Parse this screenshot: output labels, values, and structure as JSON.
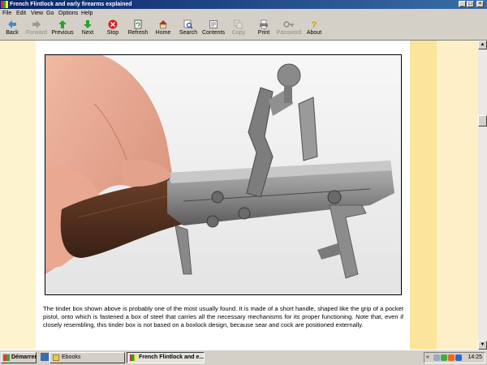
{
  "window": {
    "title": "French Flintlock and early firearms explained",
    "controls": [
      "_",
      "□",
      "×"
    ]
  },
  "menu": [
    "File",
    "Edit",
    "View",
    "Go",
    "Options",
    "Help"
  ],
  "toolbar": [
    {
      "label": "Back",
      "icon": "back-arrow-icon",
      "enabled": true
    },
    {
      "label": "Forward",
      "icon": "forward-arrow-icon",
      "enabled": false
    },
    {
      "label": "Previous",
      "icon": "up-arrow-icon",
      "enabled": true
    },
    {
      "label": "Next",
      "icon": "down-arrow-icon",
      "enabled": true
    },
    {
      "label": "Stop",
      "icon": "stop-icon",
      "enabled": true
    },
    {
      "label": "Refresh",
      "icon": "refresh-icon",
      "enabled": true
    },
    {
      "label": "Home",
      "icon": "home-icon",
      "enabled": true
    },
    {
      "label": "Search",
      "icon": "search-icon",
      "enabled": true
    },
    {
      "label": "Contents",
      "icon": "contents-icon",
      "enabled": true
    },
    {
      "label": "Copy",
      "icon": "copy-icon",
      "enabled": false
    },
    {
      "label": "Print",
      "icon": "print-icon",
      "enabled": true
    },
    {
      "label": "Password",
      "icon": "key-icon",
      "enabled": false
    },
    {
      "label": "About",
      "icon": "about-icon",
      "enabled": true
    }
  ],
  "page": {
    "body_text": "The tinder box shown above is probably one of the most usually found. It is made of a short handle, shaped like the grip of a pocket pistol, onto which is fastened a box of steel that carries all the necessary mechanisms for its proper functioning. Note that, even if closely resembling, this tinder box is not based on a boxlock design, because sear and cock are positioned externally."
  },
  "taskbar": {
    "start_label": "Démarrer",
    "tasks": [
      {
        "label": "Ebooks",
        "active": false
      },
      {
        "label": "French Flintlock and e...",
        "active": true
      }
    ],
    "tray_arrows": "«",
    "clock": "14:25"
  },
  "colors": {
    "titlebar_start": "#0a246a",
    "page_background": "#fbe59c",
    "content_background": "#ffffff"
  }
}
